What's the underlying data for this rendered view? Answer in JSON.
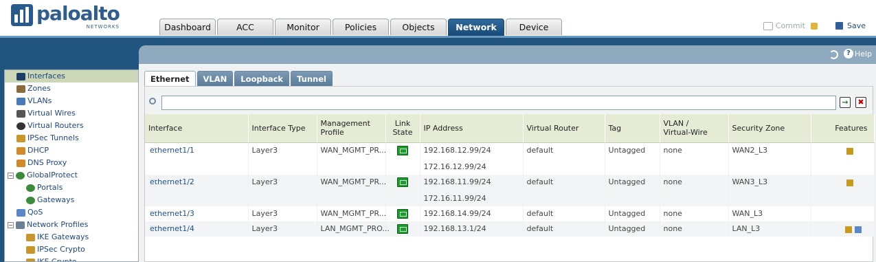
{
  "brand": {
    "name": "paloalto",
    "sub": "NETWORKS"
  },
  "main_tabs": [
    {
      "label": "Dashboard",
      "active": false
    },
    {
      "label": "ACC",
      "active": false
    },
    {
      "label": "Monitor",
      "active": false
    },
    {
      "label": "Policies",
      "active": false
    },
    {
      "label": "Objects",
      "active": false
    },
    {
      "label": "Network",
      "active": true
    },
    {
      "label": "Device",
      "active": false
    }
  ],
  "header_actions": {
    "commit": "Commit",
    "save": "Save"
  },
  "panel": {
    "help": "Help"
  },
  "sub_tabs": [
    {
      "label": "Ethernet",
      "active": true
    },
    {
      "label": "VLAN",
      "active": false
    },
    {
      "label": "Loopback",
      "active": false
    },
    {
      "label": "Tunnel",
      "active": false
    }
  ],
  "filter": {
    "value": "",
    "go": "→",
    "clear": "✖"
  },
  "table": {
    "headers": [
      "Interface",
      "Interface Type",
      "Management\nProfile",
      "Link\nState",
      "IP Address",
      "Virtual Router",
      "Tag",
      "VLAN /\nVirtual-Wire",
      "Security Zone",
      "Features"
    ],
    "rows": [
      {
        "interface": "ethernet1/1",
        "type": "Layer3",
        "mgmt": "WAN_MGMT_PR...",
        "ip": [
          "192.168.12.99/24",
          "172.16.12.99/24"
        ],
        "router": "default",
        "tag": "Untagged",
        "vlan": "none",
        "zone": "WAN2_L3",
        "features": [
          "qos-icon"
        ]
      },
      {
        "interface": "ethernet1/2",
        "type": "Layer3",
        "mgmt": "WAN_MGMT_PR...",
        "ip": [
          "192.168.11.99/24",
          "172.16.11.99/24"
        ],
        "router": "default",
        "tag": "Untagged",
        "vlan": "none",
        "zone": "WAN3_L3",
        "features": [
          "qos-icon"
        ]
      },
      {
        "interface": "ethernet1/3",
        "type": "Layer3",
        "mgmt": "WAN_MGMT_PR...",
        "ip": [
          "192.168.14.99/24"
        ],
        "router": "default",
        "tag": "Untagged",
        "vlan": "none",
        "zone": "WAN_L3",
        "features": []
      },
      {
        "interface": "ethernet1/4",
        "type": "Layer3",
        "mgmt": "LAN_MGMT_PRO...",
        "ip": [
          "192.168.13.1/24"
        ],
        "router": "default",
        "tag": "Untagged",
        "vlan": "none",
        "zone": "LAN_L3",
        "features": [
          "dhcp-icon",
          "qos-icon"
        ]
      }
    ]
  },
  "sidebar": {
    "items": [
      {
        "label": "Interfaces",
        "icon": "interfaces-icon",
        "selected": true,
        "indent": "ind-0"
      },
      {
        "label": "Zones",
        "icon": "zones-icon",
        "indent": "ind-0"
      },
      {
        "label": "VLANs",
        "icon": "vlans-icon",
        "indent": "ind-0"
      },
      {
        "label": "Virtual Wires",
        "icon": "virtual-wires-icon",
        "indent": "ind-0"
      },
      {
        "label": "Virtual Routers",
        "icon": "virtual-routers-icon",
        "indent": "ind-0"
      },
      {
        "label": "IPSec Tunnels",
        "icon": "ipsec-tunnels-icon",
        "indent": "ind-0"
      },
      {
        "label": "DHCP",
        "icon": "dhcp-icon",
        "indent": "ind-0"
      },
      {
        "label": "DNS Proxy",
        "icon": "dns-proxy-icon",
        "indent": "ind-0"
      },
      {
        "label": "GlobalProtect",
        "icon": "globalprotect-icon",
        "indent": "ind-exp",
        "expand": "−"
      },
      {
        "label": "Portals",
        "icon": "portals-icon",
        "indent": "ind-1"
      },
      {
        "label": "Gateways",
        "icon": "gateways-icon",
        "indent": "ind-1"
      },
      {
        "label": "QoS",
        "icon": "qos-icon",
        "indent": "ind-0"
      },
      {
        "label": "Network Profiles",
        "icon": "network-profiles-icon",
        "indent": "ind-exp",
        "expand": "−"
      },
      {
        "label": "IKE Gateways",
        "icon": "ike-gateways-icon",
        "indent": "ind-1"
      },
      {
        "label": "IPSec Crypto",
        "icon": "ipsec-crypto-icon",
        "indent": "ind-1"
      },
      {
        "label": "IKE Crypto",
        "icon": "ike-crypto-icon",
        "indent": "ind-1"
      }
    ]
  },
  "colors": {
    "brand": "#2f5e8e",
    "active_tab": "#184a78",
    "band": "#225480",
    "panel_header": "#8fa9bf",
    "table_header": "#e6ebd6",
    "link_up": "#1f9a2f",
    "selected_nav": "#cbd7b7"
  }
}
